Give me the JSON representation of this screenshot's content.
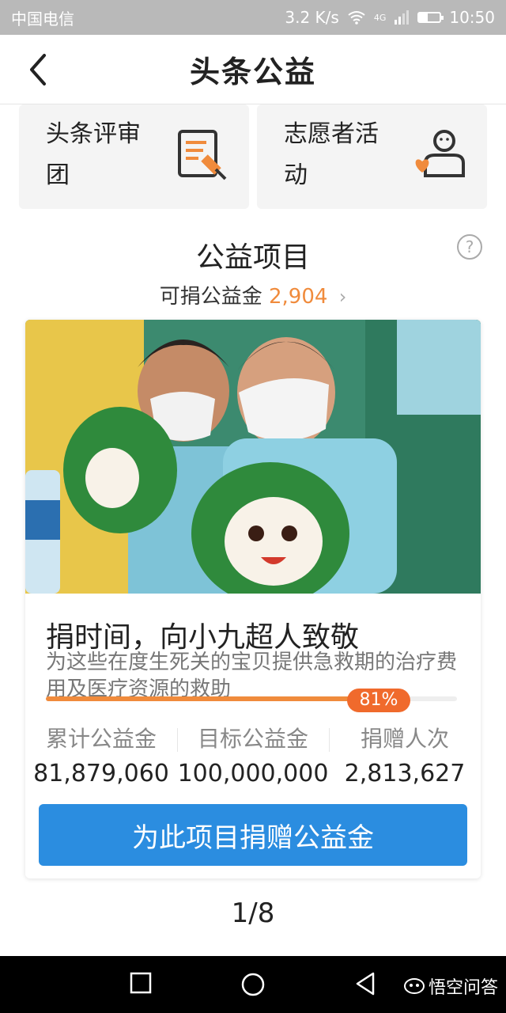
{
  "status_bar": {
    "carrier": "中国电信",
    "speed": "3.2 K/s",
    "network": "4G",
    "time": "10:50"
  },
  "nav": {
    "title": "头条公益"
  },
  "entries": [
    {
      "label": "头条评审团",
      "icon": "review-document-icon"
    },
    {
      "label": "志愿者活动",
      "icon": "volunteer-heart-icon"
    }
  ],
  "section": {
    "title": "公益项目",
    "fund_label": "可捐公益金",
    "fund_amount": "2,904"
  },
  "project": {
    "title": "捐时间，向小九超人致敬",
    "description": "为这些在度生死关的宝贝提供急救期的治疗费用及医疗资源的救助",
    "progress": 0.81,
    "progress_label": "81%",
    "stats": [
      {
        "label": "累计公益金",
        "value": "81,879,060"
      },
      {
        "label": "目标公益金",
        "value": "100,000,000"
      },
      {
        "label": "捐赠人次",
        "value": "2,813,627"
      }
    ],
    "donate_button": "为此项目捐赠公益金"
  },
  "pager": "1/8",
  "watermark": "悟空问答",
  "colors": {
    "accent_orange": "#f08b3c",
    "badge_orange": "#f06a2c",
    "button_blue": "#2b8de0"
  }
}
